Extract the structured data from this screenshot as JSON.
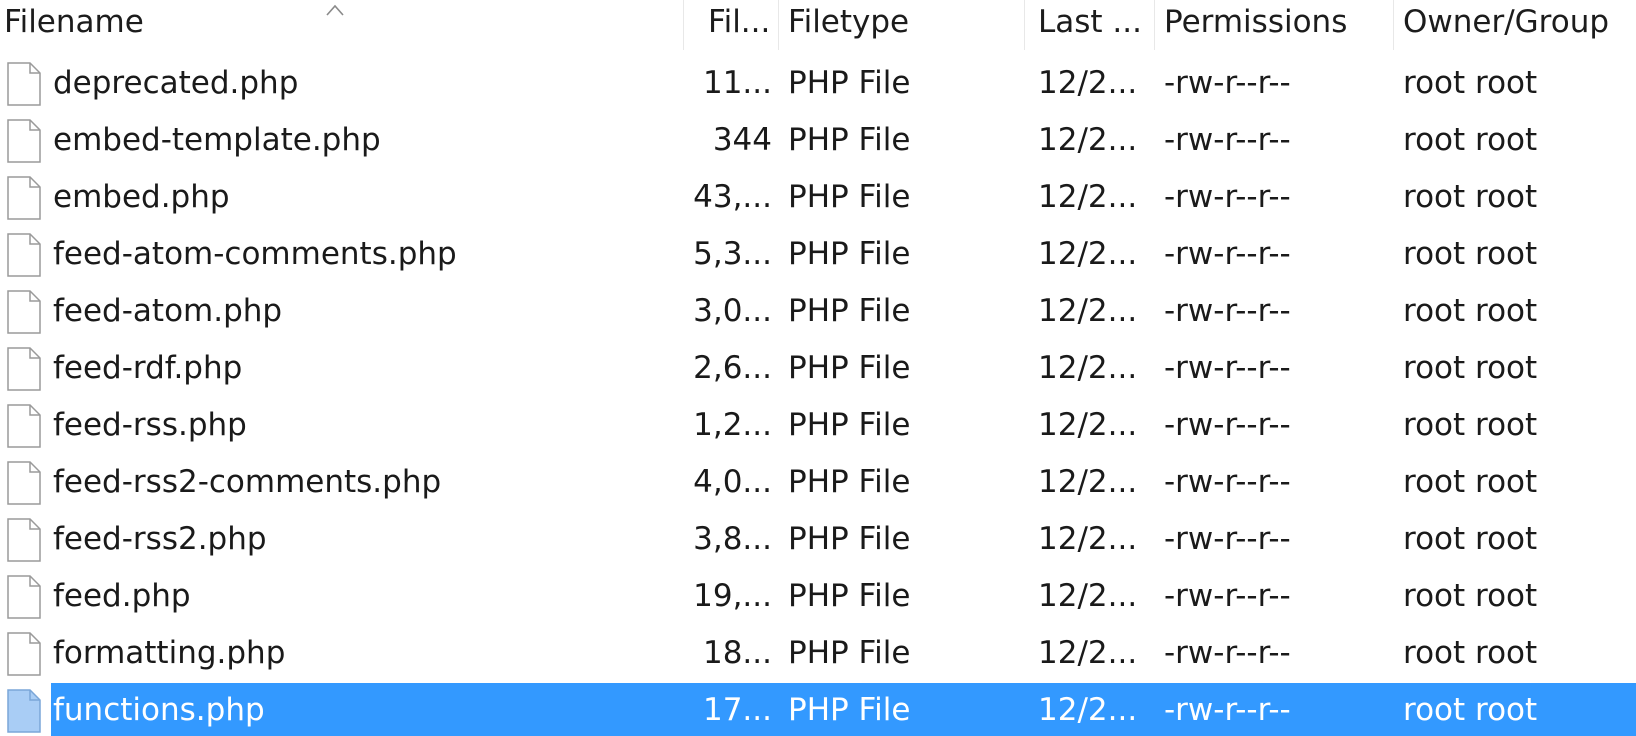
{
  "columns": {
    "filename": "Filename",
    "filesize": "Fil...",
    "filetype": "Filetype",
    "last_modified": "Last ...",
    "permissions": "Permissions",
    "owner_group": "Owner/Group"
  },
  "sort": {
    "column": "filename",
    "direction": "ascending",
    "icon": "sort-ascending-icon"
  },
  "file_icon": "document-icon",
  "rows": [
    {
      "name": "deprecated.php",
      "size": "11...",
      "type": "PHP File",
      "modified": "12/2...",
      "perms": "-rw-r--r--",
      "owner": "root root",
      "selected": false
    },
    {
      "name": "embed-template.php",
      "size": "344",
      "type": "PHP File",
      "modified": "12/2...",
      "perms": "-rw-r--r--",
      "owner": "root root",
      "selected": false
    },
    {
      "name": "embed.php",
      "size": "43,...",
      "type": "PHP File",
      "modified": "12/2...",
      "perms": "-rw-r--r--",
      "owner": "root root",
      "selected": false
    },
    {
      "name": "feed-atom-comments.php",
      "size": "5,3...",
      "type": "PHP File",
      "modified": "12/2...",
      "perms": "-rw-r--r--",
      "owner": "root root",
      "selected": false
    },
    {
      "name": "feed-atom.php",
      "size": "3,0...",
      "type": "PHP File",
      "modified": "12/2...",
      "perms": "-rw-r--r--",
      "owner": "root root",
      "selected": false
    },
    {
      "name": "feed-rdf.php",
      "size": "2,6...",
      "type": "PHP File",
      "modified": "12/2...",
      "perms": "-rw-r--r--",
      "owner": "root root",
      "selected": false
    },
    {
      "name": "feed-rss.php",
      "size": "1,2...",
      "type": "PHP File",
      "modified": "12/2...",
      "perms": "-rw-r--r--",
      "owner": "root root",
      "selected": false
    },
    {
      "name": "feed-rss2-comments.php",
      "size": "4,0...",
      "type": "PHP File",
      "modified": "12/2...",
      "perms": "-rw-r--r--",
      "owner": "root root",
      "selected": false
    },
    {
      "name": "feed-rss2.php",
      "size": "3,8...",
      "type": "PHP File",
      "modified": "12/2...",
      "perms": "-rw-r--r--",
      "owner": "root root",
      "selected": false
    },
    {
      "name": "feed.php",
      "size": "19,...",
      "type": "PHP File",
      "modified": "12/2...",
      "perms": "-rw-r--r--",
      "owner": "root root",
      "selected": false
    },
    {
      "name": "formatting.php",
      "size": "18...",
      "type": "PHP File",
      "modified": "12/2...",
      "perms": "-rw-r--r--",
      "owner": "root root",
      "selected": false
    },
    {
      "name": "functions.php",
      "size": "17...",
      "type": "PHP File",
      "modified": "12/2...",
      "perms": "-rw-r--r--",
      "owner": "root root",
      "selected": true
    }
  ],
  "colors": {
    "selection": "#3399ff",
    "text": "#1a1a1a",
    "selected_text": "#ffffff",
    "header_separator": "#e8e8e8"
  }
}
